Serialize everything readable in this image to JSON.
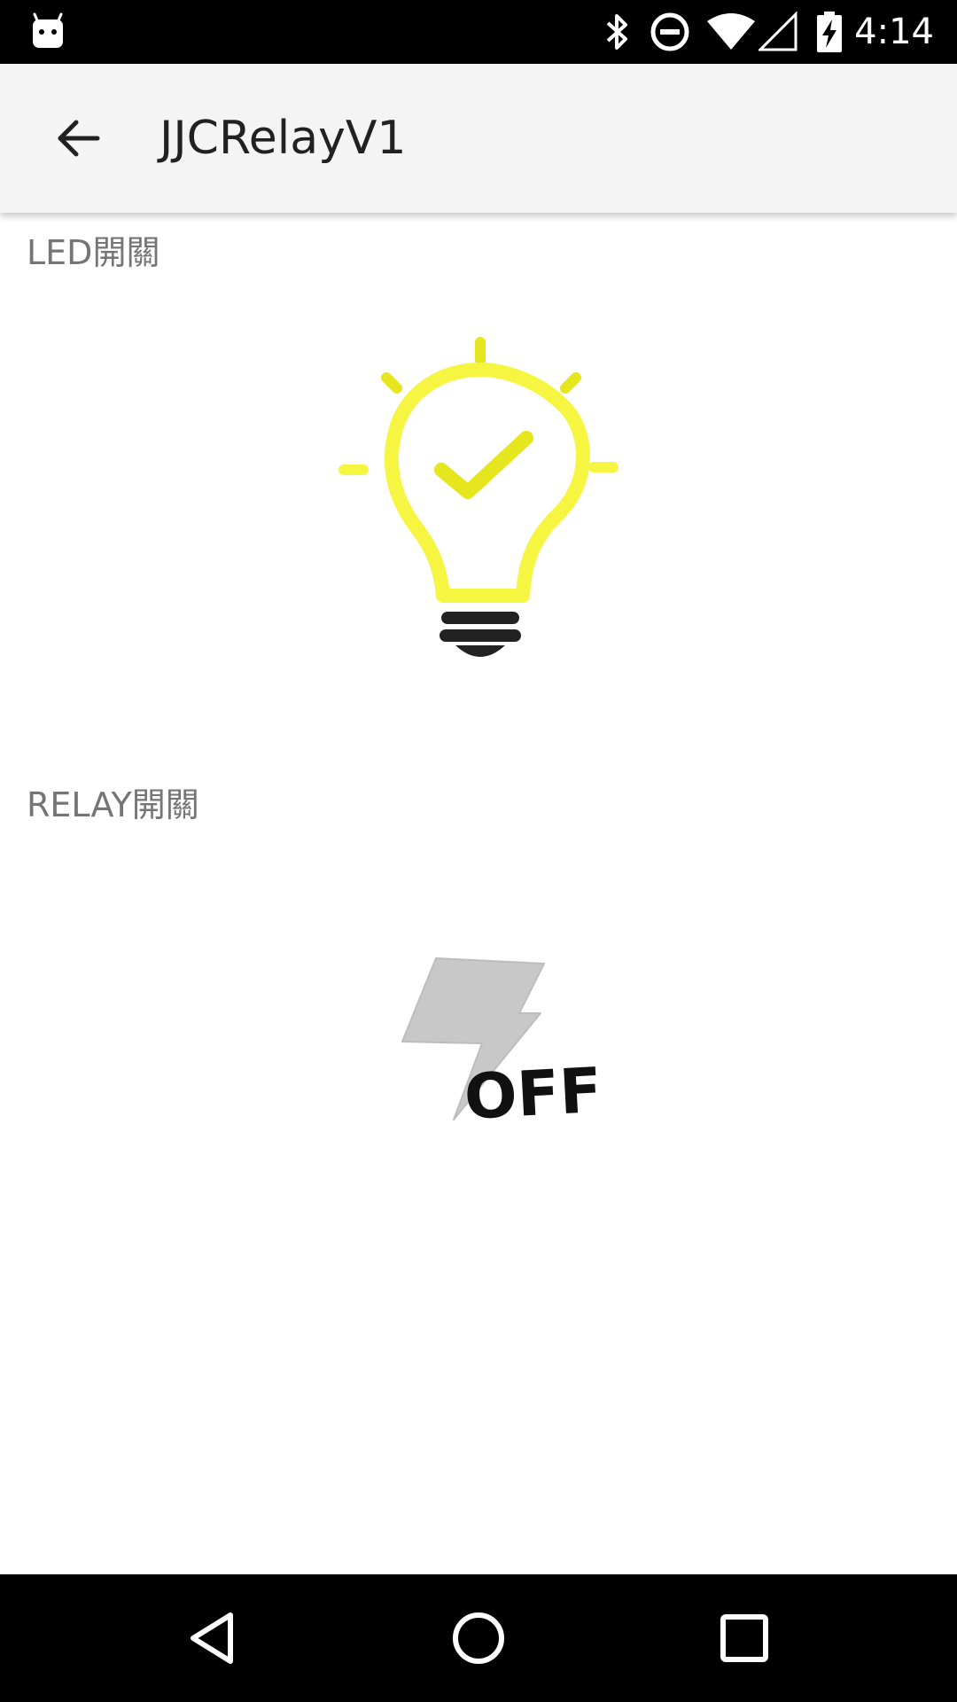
{
  "status_bar": {
    "time": "4:14",
    "icons": [
      "android-notification-icon",
      "bluetooth-icon",
      "do-not-disturb-icon",
      "wifi-icon",
      "cellular-signal-icon",
      "battery-charging-icon"
    ]
  },
  "app_bar": {
    "title": "JJCRelayV1",
    "back_icon": "arrow-back-icon"
  },
  "led_section": {
    "label": "LED開關",
    "state_icon": "lightbulb-on-icon",
    "colors": {
      "bulb": "#f5f542",
      "check": "#e6e61e",
      "base": "#222222"
    }
  },
  "relay_section": {
    "label": "RELAY開關",
    "state_icon": "lightning-off-icon",
    "status_text": "OFF",
    "colors": {
      "bolt": "#c8c8c8",
      "text": "#111111"
    }
  },
  "nav_bar": {
    "buttons": [
      "nav-back-icon",
      "nav-home-icon",
      "nav-recents-icon"
    ]
  }
}
